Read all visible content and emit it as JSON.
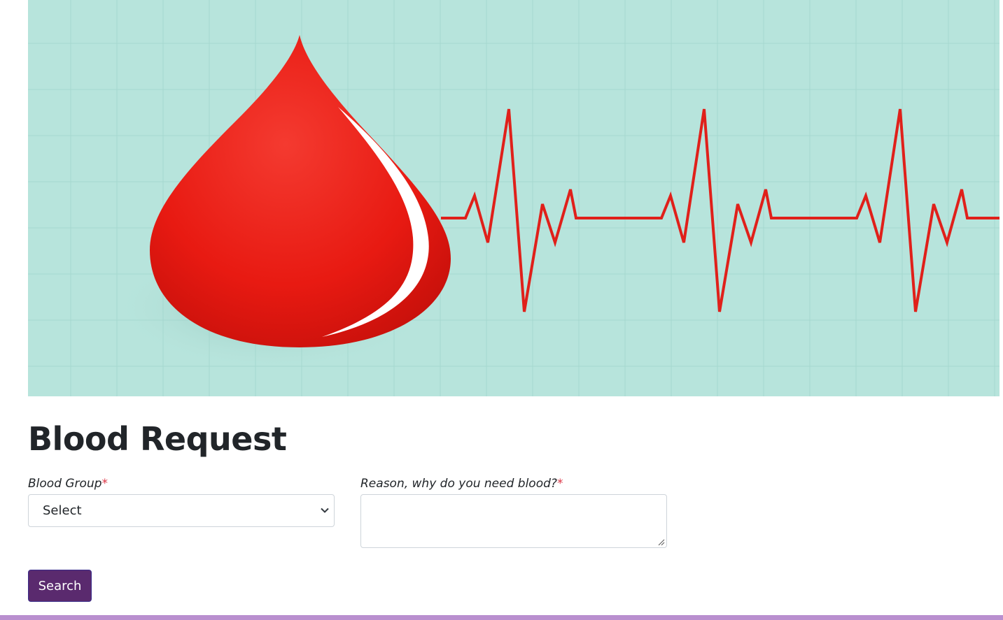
{
  "page": {
    "title": "Blood Request"
  },
  "banner": {
    "image": "blood-drop-heartbeat-illustration",
    "colors": {
      "background": "#b7e4dc",
      "drop": "#e8231c",
      "heartbeat_line": "#e0201a"
    }
  },
  "form": {
    "blood_group": {
      "label": "Blood Group",
      "required_mark": "*",
      "selected_value": "Select"
    },
    "reason": {
      "label": "Reason, why do you need blood?",
      "required_mark": "*",
      "value": ""
    },
    "search_button": {
      "label": "Search",
      "color": "#5a2a6e"
    }
  },
  "footer": {
    "color": "#b98fcf"
  }
}
